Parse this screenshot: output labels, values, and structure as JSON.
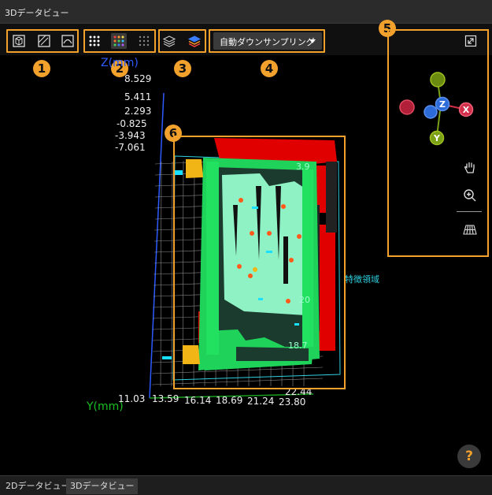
{
  "window": {
    "title": "3Dデータビュー"
  },
  "toolbar": {
    "dropdown_value": "自動ダウンサンプリング"
  },
  "badges": [
    "1",
    "2",
    "3",
    "4",
    "5",
    "6"
  ],
  "axes": {
    "z_label": "Z(mm)",
    "z_ticks": [
      "8.529",
      "5.411",
      "2.293",
      "-0.825",
      "-3.943",
      "-7.061"
    ],
    "y_label": "Y(mm)",
    "y_ticks": [
      "11.03",
      "13.59",
      "16.14",
      "18.69",
      "21.24",
      "23.80"
    ],
    "y_tick_upper": "22.44"
  },
  "scene": {
    "region_label": "特徴領域",
    "point_labels": [
      "3.9",
      "20",
      "18.7"
    ]
  },
  "orientation": {
    "z": "Z",
    "x": "X",
    "y": "Y"
  },
  "tabs": [
    {
      "label": "2Dデータビュー",
      "active": false
    },
    {
      "label": "3Dデータビュー",
      "active": true
    }
  ],
  "help_label": "?"
}
